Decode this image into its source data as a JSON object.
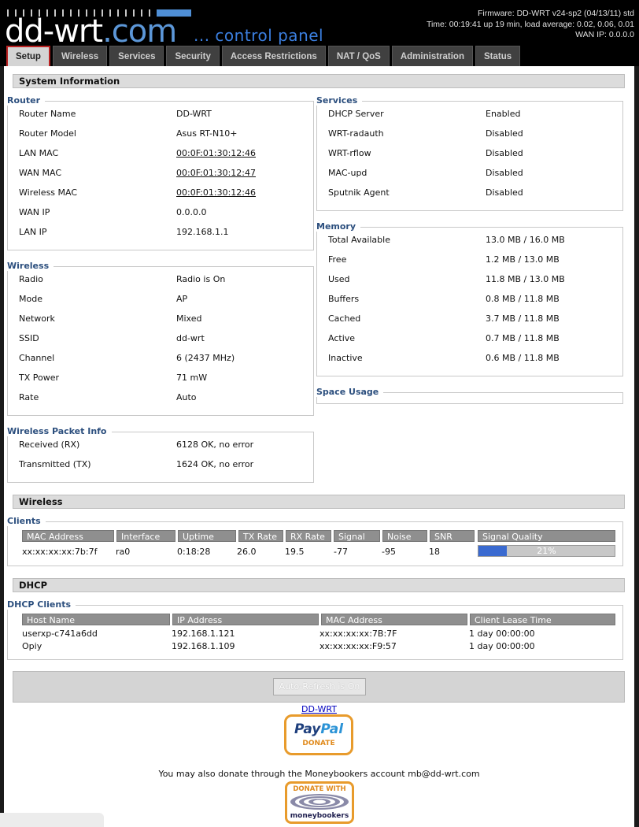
{
  "header": {
    "logo_main": "dd-wrt",
    "logo_com": ".com",
    "control_panel": "... control panel",
    "firmware": "Firmware: DD-WRT v24-sp2 (04/13/11) std",
    "time": "Time: 00:19:41 up 19 min, load average: 0.02, 0.06, 0.01",
    "wan_ip": "WAN IP: 0.0.0.0"
  },
  "tabs": [
    "Setup",
    "Wireless",
    "Services",
    "Security",
    "Access Restrictions",
    "NAT / QoS",
    "Administration",
    "Status"
  ],
  "system_info": {
    "title": "System Information",
    "router": {
      "legend": "Router",
      "rows": [
        {
          "label": "Router Name",
          "value": "DD-WRT"
        },
        {
          "label": "Router Model",
          "value": "Asus RT-N10+"
        },
        {
          "label": "LAN MAC",
          "value": "00:0F:01:30:12:46"
        },
        {
          "label": "WAN MAC",
          "value": "00:0F:01:30:12:47"
        },
        {
          "label": "Wireless MAC",
          "value": "00:0F:01:30:12:46"
        },
        {
          "label": "WAN IP",
          "value": "0.0.0.0"
        },
        {
          "label": "LAN IP",
          "value": "192.168.1.1"
        }
      ]
    },
    "wireless": {
      "legend": "Wireless",
      "rows": [
        {
          "label": "Radio",
          "value": "Radio is On"
        },
        {
          "label": "Mode",
          "value": "AP"
        },
        {
          "label": "Network",
          "value": "Mixed"
        },
        {
          "label": "SSID",
          "value": "dd-wrt"
        },
        {
          "label": "Channel",
          "value": "6 (2437 MHz)"
        },
        {
          "label": "TX Power",
          "value": "71 mW"
        },
        {
          "label": "Rate",
          "value": "Auto"
        }
      ]
    },
    "packet_info": {
      "legend": "Wireless Packet Info",
      "rows": [
        {
          "label": "Received (RX)",
          "value": "6128 OK, no error"
        },
        {
          "label": "Transmitted (TX)",
          "value": "1624 OK, no error"
        }
      ]
    },
    "services": {
      "legend": "Services",
      "rows": [
        {
          "label": "DHCP Server",
          "value": "Enabled"
        },
        {
          "label": "WRT-radauth",
          "value": "Disabled"
        },
        {
          "label": "WRT-rflow",
          "value": "Disabled"
        },
        {
          "label": "MAC-upd",
          "value": "Disabled"
        },
        {
          "label": "Sputnik Agent",
          "value": "Disabled"
        }
      ]
    },
    "memory": {
      "legend": "Memory",
      "rows": [
        {
          "label": "Total Available",
          "value": "13.0 MB / 16.0 MB"
        },
        {
          "label": "Free",
          "value": "1.2 MB / 13.0 MB"
        },
        {
          "label": "Used",
          "value": "11.8 MB / 13.0 MB"
        },
        {
          "label": "Buffers",
          "value": "0.8 MB / 11.8 MB"
        },
        {
          "label": "Cached",
          "value": "3.7 MB / 11.8 MB"
        },
        {
          "label": "Active",
          "value": "0.7 MB / 11.8 MB"
        },
        {
          "label": "Inactive",
          "value": "0.6 MB / 11.8 MB"
        }
      ]
    },
    "space_usage": {
      "legend": "Space Usage"
    }
  },
  "wireless_section": {
    "title": "Wireless",
    "clients_legend": "Clients",
    "columns": [
      "MAC Address",
      "Interface",
      "Uptime",
      "TX Rate",
      "RX Rate",
      "Signal",
      "Noise",
      "SNR",
      "Signal Quality"
    ],
    "rows": [
      {
        "mac": "xx:xx:xx:xx:7b:7f",
        "interface": "ra0",
        "uptime": "0:18:28",
        "tx": "26.0",
        "rx": "19.5",
        "signal": "-77",
        "noise": "-95",
        "snr": "18",
        "quality": "21%",
        "quality_value": 21
      }
    ]
  },
  "dhcp": {
    "title": "DHCP",
    "clients_legend": "DHCP Clients",
    "columns": [
      "Host Name",
      "IP Address",
      "MAC Address",
      "Client Lease Time"
    ],
    "rows": [
      {
        "host": "userxp-c741a6dd",
        "ip": "192.168.1.121",
        "mac": "xx:xx:xx:xx:7B:7F",
        "lease": "1 day 00:00:00"
      },
      {
        "host": "Opiy",
        "ip": "192.168.1.109",
        "mac": "xx:xx:xx:xx:F9:57",
        "lease": "1 day 00:00:00"
      }
    ]
  },
  "footer": {
    "refresh_button": "Auto-Refresh is On",
    "ddwrt_link": "DD-WRT",
    "paypal_1": "Pay",
    "paypal_2": "Pal",
    "paypal_donate": "DONATE",
    "moneybookers_text": "You may also donate through the Moneybookers account mb@dd-wrt.com",
    "mb_donate_with": "DONATE WITH",
    "mb_brand": "moneybookers"
  }
}
